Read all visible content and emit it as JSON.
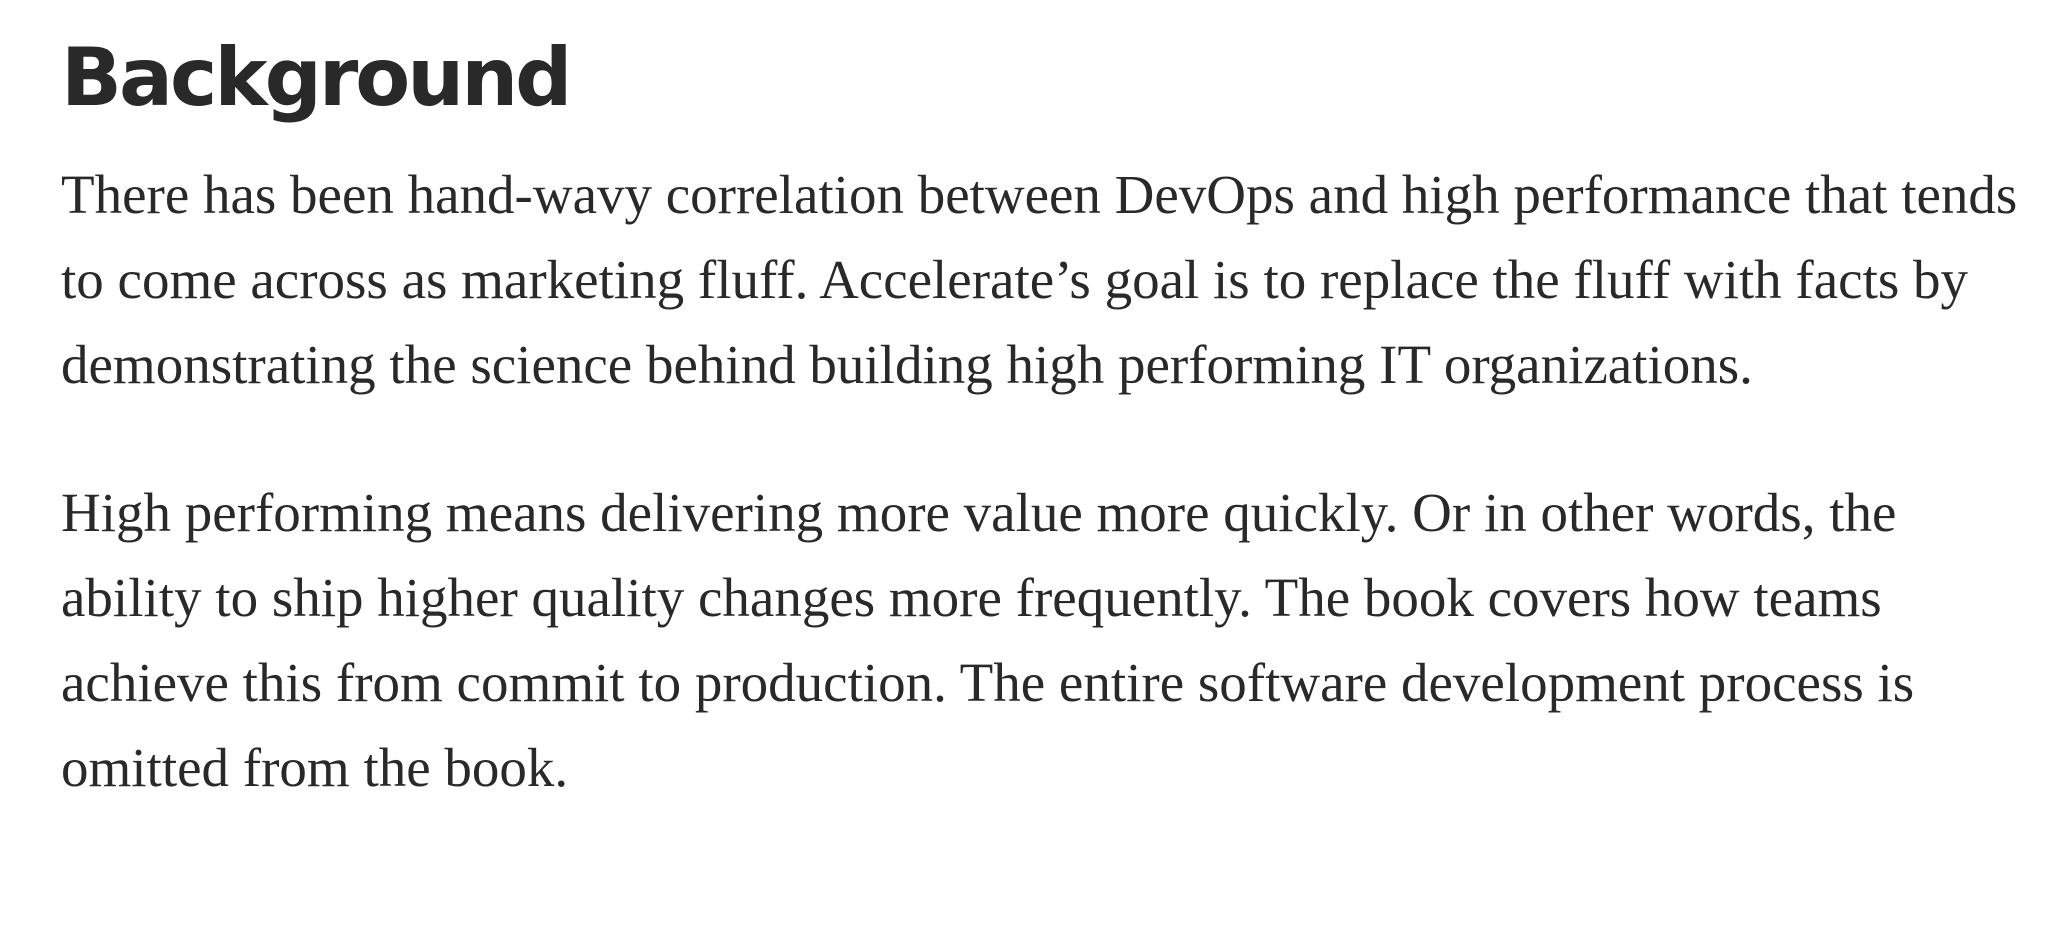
{
  "article": {
    "heading": "Background",
    "paragraphs": [
      "There has been hand-wavy correlation between DevOps and high performance that tends to come across as marketing fluff. Accelerate’s goal is to replace the fluff with facts by demonstrating the science behind building high performing IT organizations.",
      "High performing means delivering more value more quickly. Or in other words, the ability to ship higher quality changes more frequently. The book covers how teams achieve this from commit to production. The entire software development process is omitted from the book."
    ]
  },
  "colors": {
    "text": "#292929",
    "background": "#ffffff"
  }
}
